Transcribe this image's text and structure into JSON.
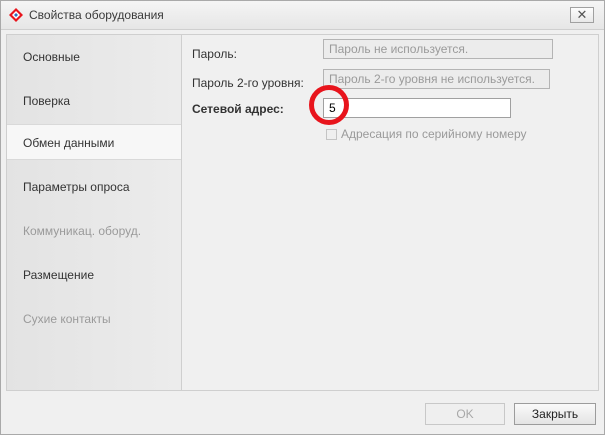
{
  "window": {
    "title": "Свойства оборудования",
    "icon": "diamond-app-icon",
    "close_glyph": "✕",
    "accent_colors": {
      "icon_red": "#e8141c",
      "icon_blue": "#2d6fc0"
    }
  },
  "sidebar": {
    "items": [
      {
        "label": "Основные",
        "state": "normal"
      },
      {
        "label": "Поверка",
        "state": "normal"
      },
      {
        "label": "Обмен данными",
        "state": "active"
      },
      {
        "label": "Параметры опроса",
        "state": "normal"
      },
      {
        "label": "Коммуникац. оборуд.",
        "state": "disabled"
      },
      {
        "label": "Размещение",
        "state": "normal"
      },
      {
        "label": "Сухие контакты",
        "state": "disabled"
      }
    ]
  },
  "form": {
    "password_label": "Пароль:",
    "password_placeholder": "Пароль не используется.",
    "password2_label": "Пароль 2-го уровня:",
    "password2_placeholder": "Пароль 2-го уровня не используется.",
    "network_address_label": "Сетевой адрес:",
    "network_address_value": "5",
    "serial_addressing_label": "Адресация по серийному номеру",
    "serial_addressing_checked": false,
    "highlight_color": "#e8141c"
  },
  "footer": {
    "ok_label": "OK",
    "close_label": "Закрыть"
  }
}
